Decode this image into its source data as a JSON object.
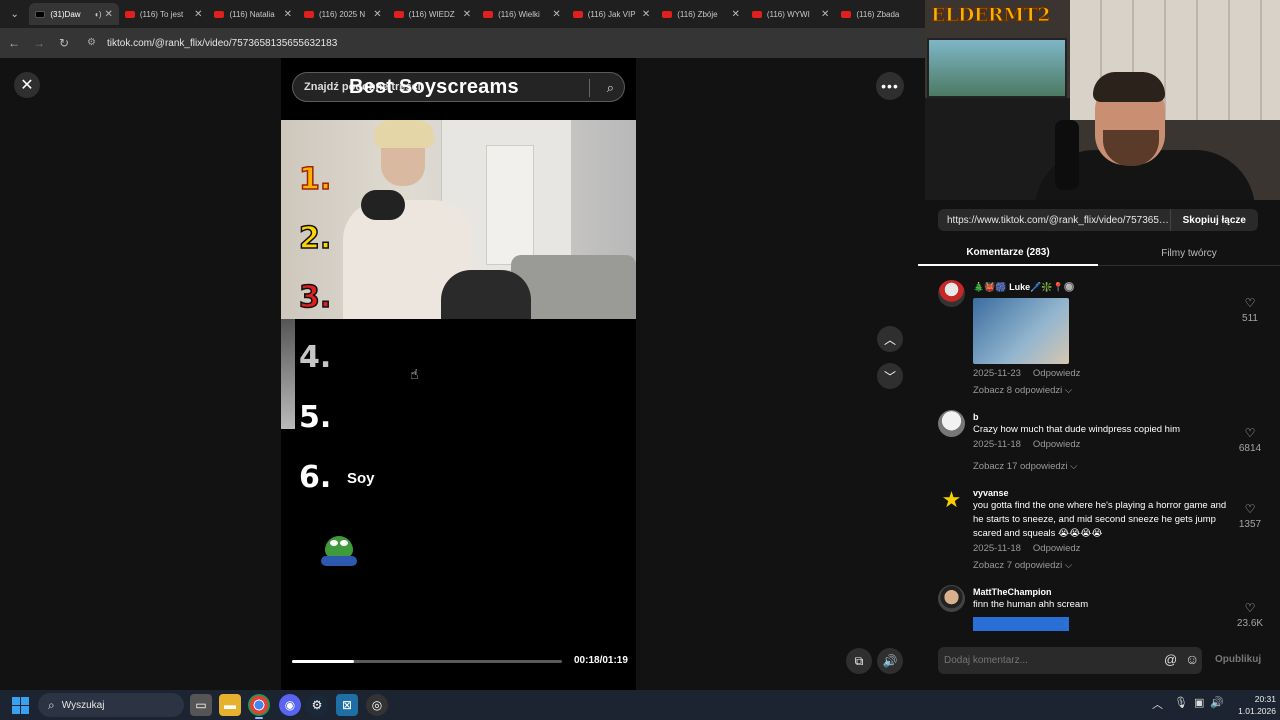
{
  "browser": {
    "tabs": [
      {
        "title": "(31)Daw",
        "icon": "tiktok-icon",
        "active": true
      },
      {
        "title": "(116) To jest",
        "icon": "youtube-icon"
      },
      {
        "title": "(116) Natalia",
        "icon": "youtube-icon"
      },
      {
        "title": "(116) 2025 N",
        "icon": "youtube-icon"
      },
      {
        "title": "(116) WIEDZ",
        "icon": "youtube-icon"
      },
      {
        "title": "(116) Wielki",
        "icon": "youtube-icon"
      },
      {
        "title": "(116) Jak VIP",
        "icon": "youtube-icon"
      },
      {
        "title": "(116) Zbóje",
        "icon": "youtube-icon"
      },
      {
        "title": "(116) WYWI",
        "icon": "youtube-icon"
      },
      {
        "title": "(116) Zbada",
        "icon": "youtube-icon"
      }
    ],
    "url": "tiktok.com/@rank_flix/video/7573658135655632183"
  },
  "video": {
    "search_placeholder": "Znajdź podobne treści",
    "title": "Best Soyscreams",
    "ranks": [
      "1.",
      "2.",
      "3.",
      "4.",
      "5.",
      "6."
    ],
    "soy_label": "Soy",
    "time": "00:18/01:19",
    "progress": 0.23
  },
  "webcam": {
    "brand": "ELDERMT2"
  },
  "panel": {
    "share_url": "https://www.tiktok.com/@rank_flix/video/75736581...",
    "copy_label": "Skopiuj łącze",
    "tab_comments": "Komentarze (283)",
    "tab_creator": "Filmy twórcy",
    "comments": [
      {
        "user": "🎄👹🎆 Luke🖊️❇️📍🔘",
        "text": "",
        "date": "2025-11-23",
        "reply": "Odpowiedz",
        "more": "Zobacz 8 odpowiedzi ⌵",
        "likes": "511",
        "has_image": true
      },
      {
        "user": "b",
        "text": "Crazy how much that dude windpress copied him",
        "date": "2025-11-18",
        "reply": "Odpowiedz",
        "more": "Zobacz 17 odpowiedzi ⌵",
        "likes": "6814"
      },
      {
        "user": "vyvanse",
        "text": "you gotta find the one where he's playing a horror game and he starts to sneeze, and mid second sneeze he gets jump scared and squeals 😭😭😭😭",
        "date": "2025-11-18",
        "reply": "Odpowiedz",
        "more": "Zobacz 7 odpowiedzi ⌵",
        "likes": "1357"
      },
      {
        "user": "MattTheChampion",
        "text": "finn the human ahh scream",
        "likes": "23.6K"
      }
    ],
    "comment_placeholder": "Dodaj komentarz...",
    "publish_label": "Opublikuj"
  },
  "taskbar": {
    "search_label": "Wyszukaj",
    "time": "20:31",
    "date": "1.01.2026"
  },
  "colors": {
    "accent": "#fe2c55",
    "panel_bg": "#121212",
    "taskbar": "#1c2331"
  }
}
